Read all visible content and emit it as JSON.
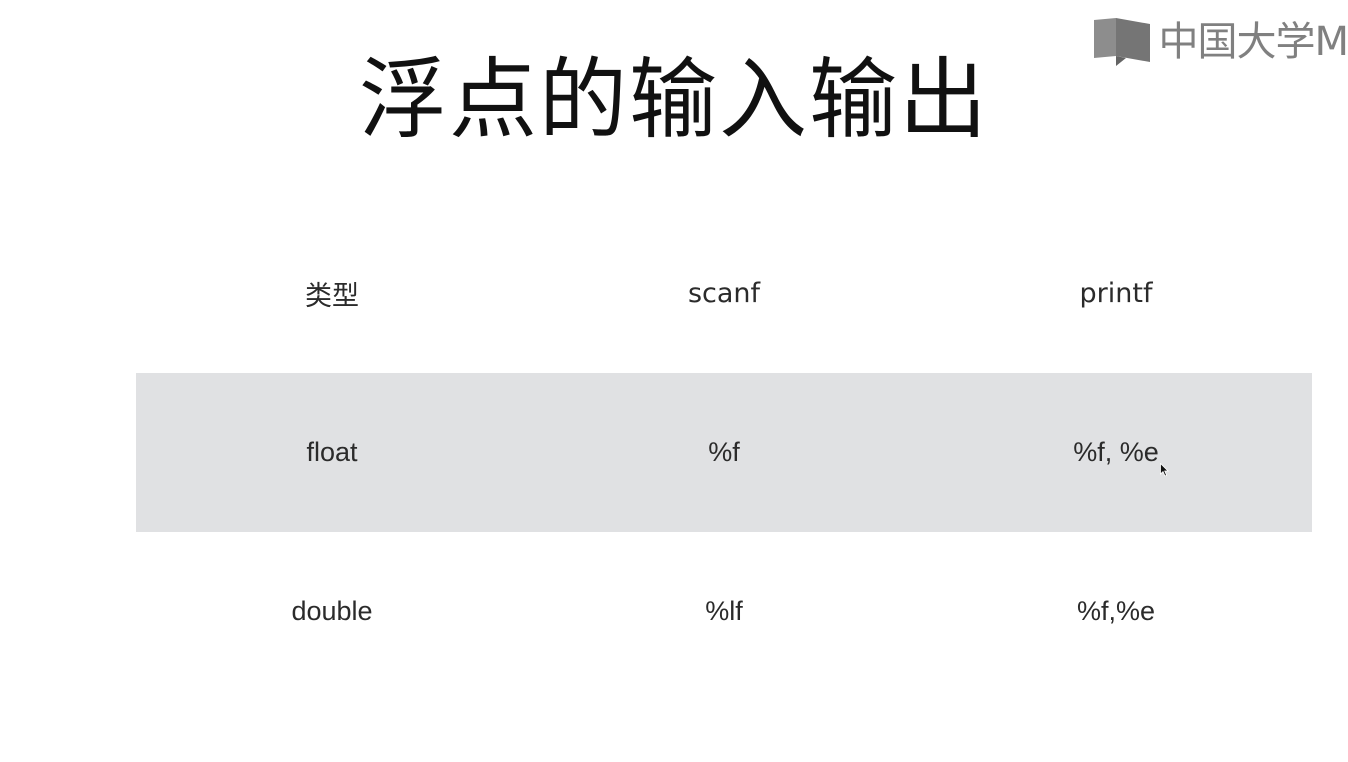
{
  "watermark": {
    "text": "中国大学M",
    "logo_icon": "book-logo-icon"
  },
  "title": "浮点的输入输出",
  "table": {
    "headers": [
      "类型",
      "scanf",
      "printf"
    ],
    "rows": [
      {
        "type": "float",
        "scanf": "%f",
        "printf": "%f, %e"
      },
      {
        "type": "double",
        "scanf": "%lf",
        "printf": "%f,%e"
      }
    ]
  },
  "colors": {
    "shaded_row": "#e0e1e3",
    "text": "#2b2b2b",
    "watermark": "#6b6b6b"
  }
}
